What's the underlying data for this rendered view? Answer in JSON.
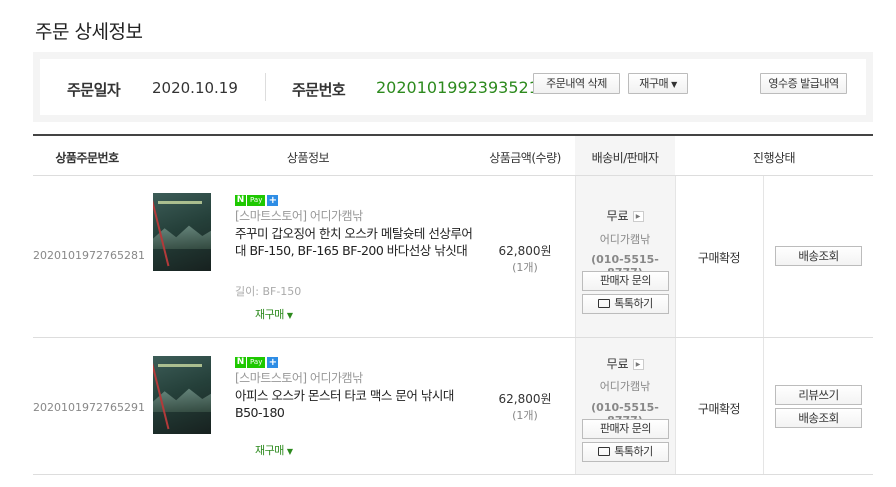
{
  "page_title": "주문 상세정보",
  "summary": {
    "date_label": "주문일자",
    "date_value": "2020.10.19",
    "order_no_label": "주문번호",
    "order_no_value": "2020101992393521",
    "delete_button": "주문내역 삭제",
    "rebuy_button": "재구매",
    "receipt_button": "영수증 발급내역"
  },
  "table": {
    "headers": {
      "product_order_no": "상품주문번호",
      "product_info": "상품정보",
      "price_qty": "상품금액(수량)",
      "shipping_seller": "배송비/판매자",
      "status": "진행상태"
    },
    "rows": [
      {
        "product_order_no": "2020101972765281",
        "npay": "Pay",
        "store": "[스마트스토어] 어디가캠낚",
        "name": "주꾸미 갑오징어 한치 오스카 메탈슛테 선상루어대 BF-150, BF-165 BF-200 바다선상 낚싯대",
        "option": "길이: BF-150",
        "rebuy": "재구매",
        "price": "62,800원",
        "qty": "(1개)",
        "shipping": "무료",
        "seller": "어디가캠낚",
        "phone": "(010-5515-8777)",
        "inquiry_button": "판매자 문의",
        "talk_button": "톡톡하기",
        "status": "구매확정",
        "actions": [
          "배송조회"
        ]
      },
      {
        "product_order_no": "2020101972765291",
        "npay": "Pay",
        "store": "[스마트스토어] 어디가캠낚",
        "name": "아피스 오스카 몬스터 타코 맥스 문어 낚시대 B50-180",
        "option": "",
        "rebuy": "재구매",
        "price": "62,800원",
        "qty": "(1개)",
        "shipping": "무료",
        "seller": "어디가캠낚",
        "phone": "(010-5515-8777)",
        "inquiry_button": "판매자 문의",
        "talk_button": "톡톡하기",
        "status": "구매확정",
        "actions": [
          "리뷰쓰기",
          "배송조회"
        ]
      }
    ]
  },
  "colors": {
    "accent_green": "#2d8a1e",
    "npay_green": "#1ec800"
  }
}
